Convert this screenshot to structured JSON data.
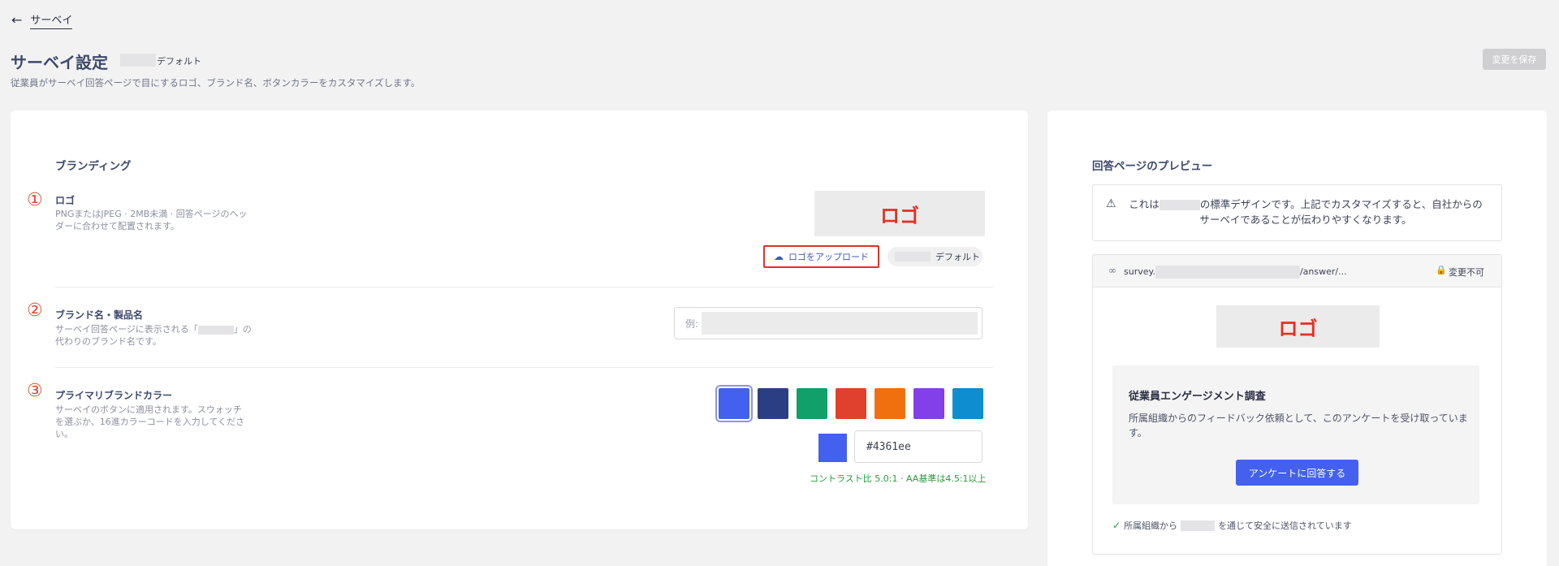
{
  "nav": {
    "back_label": "サーベイ"
  },
  "header": {
    "title": "サーベイ設定",
    "title_suffix": "デフォルト",
    "subtitle": "従業員がサーベイ回答ページで目にするロゴ、ブランド名、ボタンカラーをカスタマイズします。",
    "save_label": "変更を保存"
  },
  "branding": {
    "section_title": "ブランディング",
    "logo": {
      "number": "①",
      "label": "ロゴ",
      "desc_line1": "PNGまたはJPEG · 2MB未満 · 回答ページのヘッ",
      "desc_line2": "ダーに合わせて配置されます。",
      "placeholder_text": "ロゴ",
      "upload_label": "ロゴをアップロード",
      "default_label": "デフォルト",
      "upload_icon": "cloud-upload-icon"
    },
    "brand_name": {
      "number": "②",
      "label": "ブランド名・製品名",
      "desc_line1_a": "サーベイ回答ページに表示される「",
      "desc_line1_b": "」の",
      "desc_line2": "代わりのブランド名です。",
      "input_prefix": "例:"
    },
    "color": {
      "number": "③",
      "label": "プライマリブランドカラー",
      "desc_line1": "サーベイのボタンに適用されます。スウォッチ",
      "desc_line2": "を選ぶか、16進カラーコードを入力してくださ",
      "desc_line3": "い。",
      "swatches": [
        "#4361ee",
        "#2c3e82",
        "#11a06a",
        "#e0402e",
        "#f07010",
        "#8440e8",
        "#0e8ed0"
      ],
      "selected": "#4361ee",
      "hex_value": "#4361ee",
      "contrast_text": "コントラスト比 5.0:1 · AA基準は4.5:1以上"
    }
  },
  "preview": {
    "title": "回答ページのプレビュー",
    "notice_a": "これは",
    "notice_b": "の標準デザインです。上記でカスタマイズすると、自社からの",
    "notice_c": "サーベイであることが伝わりやすくなります。",
    "url_prefix": "survey.",
    "url_suffix": "/answer/...",
    "url_lock_label": "変更不可",
    "logo_text": "ロゴ",
    "survey_title": "従業員エンゲージメント調査",
    "survey_desc": "所属組織からのフィードバック依頼として、このアンケートを受け取っています。",
    "answer_button": "アンケートに回答する",
    "secure_a": "所属組織から",
    "secure_b": "を通じて安全に送信されています"
  }
}
